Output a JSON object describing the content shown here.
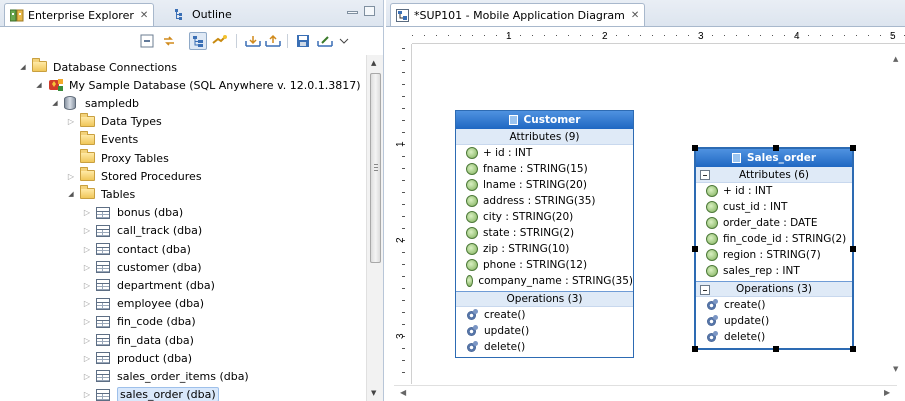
{
  "left": {
    "tabs": [
      {
        "label": "Enterprise Explorer",
        "icon": "enterprise-explorer-icon",
        "closable": true
      },
      {
        "label": "Outline",
        "icon": "outline-icon"
      }
    ],
    "tree": [
      {
        "label": "Database Connections",
        "level": 0,
        "expanded": true,
        "icon": "folder-open-icon"
      },
      {
        "label": "My Sample Database (SQL Anywhere v. 12.0.1.3817)",
        "level": 1,
        "expanded": true,
        "icon": "db-connection-icon"
      },
      {
        "label": "sampledb",
        "level": 2,
        "expanded": true,
        "icon": "database-icon"
      },
      {
        "label": "Data Types",
        "level": 3,
        "expandable": true,
        "icon": "folder-icon"
      },
      {
        "label": "Events",
        "level": 3,
        "icon": "folder-icon"
      },
      {
        "label": "Proxy Tables",
        "level": 3,
        "icon": "folder-icon"
      },
      {
        "label": "Stored Procedures",
        "level": 3,
        "expandable": true,
        "icon": "folder-icon"
      },
      {
        "label": "Tables",
        "level": 3,
        "expanded": true,
        "icon": "folder-icon"
      },
      {
        "label": "bonus (dba)",
        "level": 4,
        "expandable": true,
        "icon": "table-icon"
      },
      {
        "label": "call_track (dba)",
        "level": 4,
        "expandable": true,
        "icon": "table-icon"
      },
      {
        "label": "contact (dba)",
        "level": 4,
        "expandable": true,
        "icon": "table-icon"
      },
      {
        "label": "customer (dba)",
        "level": 4,
        "expandable": true,
        "icon": "table-icon"
      },
      {
        "label": "department (dba)",
        "level": 4,
        "expandable": true,
        "icon": "table-icon"
      },
      {
        "label": "employee (dba)",
        "level": 4,
        "expandable": true,
        "icon": "table-icon"
      },
      {
        "label": "fin_code (dba)",
        "level": 4,
        "expandable": true,
        "icon": "table-icon"
      },
      {
        "label": "fin_data (dba)",
        "level": 4,
        "expandable": true,
        "icon": "table-icon"
      },
      {
        "label": "product (dba)",
        "level": 4,
        "expandable": true,
        "icon": "table-icon"
      },
      {
        "label": "sales_order_items (dba)",
        "level": 4,
        "expandable": true,
        "icon": "table-icon"
      },
      {
        "label": "sales_order (dba)",
        "level": 4,
        "expandable": true,
        "icon": "table-icon",
        "selected": true
      }
    ]
  },
  "editor": {
    "tab_label": "*SUP101 - Mobile Application Diagram",
    "ruler_h": [
      "1",
      "2",
      "3",
      "4",
      "5"
    ],
    "ruler_v": [
      "1",
      "2",
      "3"
    ]
  },
  "customer": {
    "title": "Customer",
    "attributes_header": "Attributes (9)",
    "attributes": [
      "+ id : INT",
      "fname : STRING(15)",
      "lname : STRING(20)",
      "address : STRING(35)",
      "city : STRING(20)",
      "state : STRING(2)",
      "zip : STRING(10)",
      "phone : STRING(12)",
      "company_name : STRING(35)"
    ],
    "operations_header": "Operations (3)",
    "operations": [
      "create()",
      "update()",
      "delete()"
    ]
  },
  "sales_order": {
    "title": "Sales_order",
    "attributes_header": "Attributes (6)",
    "attributes": [
      "+ id : INT",
      "cust_id : INT",
      "order_date : DATE",
      "fin_code_id : STRING(2)",
      "region : STRING(7)",
      "sales_rep : INT"
    ],
    "operations_header": "Operations (3)",
    "operations": [
      "create()",
      "update()",
      "delete()"
    ]
  },
  "colors": {
    "accent": "#1f67c2",
    "selection": "#d9e8fb"
  }
}
